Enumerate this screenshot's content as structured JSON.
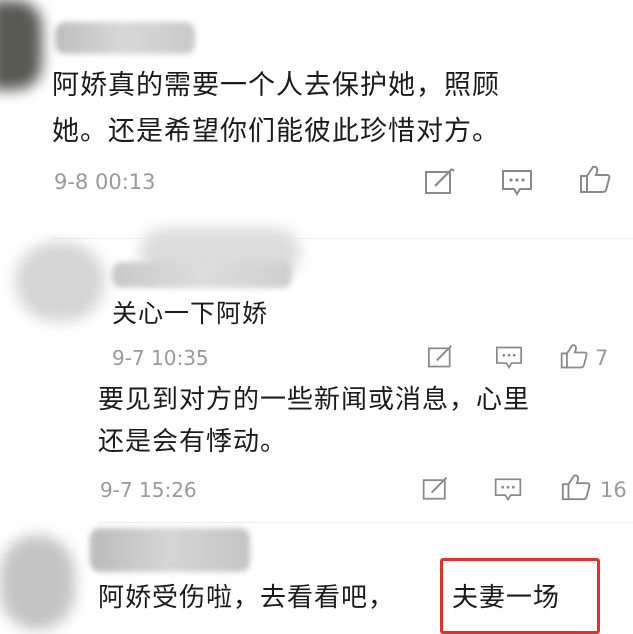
{
  "comment_1": {
    "text_line1": "阿娇真的需要一个人去保护她，照顾",
    "text_line2": "她。还是希望你们能彼此珍惜对方。",
    "time": "9-8 00:13"
  },
  "comment_2": {
    "text": "关心一下阿娇",
    "time": "9-7 10:35",
    "like_count": "7"
  },
  "reply_1": {
    "text_line1": "要见到对方的一些新闻或消息，心里",
    "text_line2": "还是会有悸动。",
    "time": "9-7 15:26",
    "like_count": "16"
  },
  "comment_3": {
    "text_before": "阿娇受伤啦，去看看吧，",
    "text_highlighted": "夫妻一场"
  },
  "colors": {
    "highlight_border": "#e2302b",
    "meta_text": "#9a9a9a",
    "body_text": "#1b1b1b"
  },
  "icons": [
    "edit-icon",
    "comment-icon",
    "like-icon"
  ]
}
